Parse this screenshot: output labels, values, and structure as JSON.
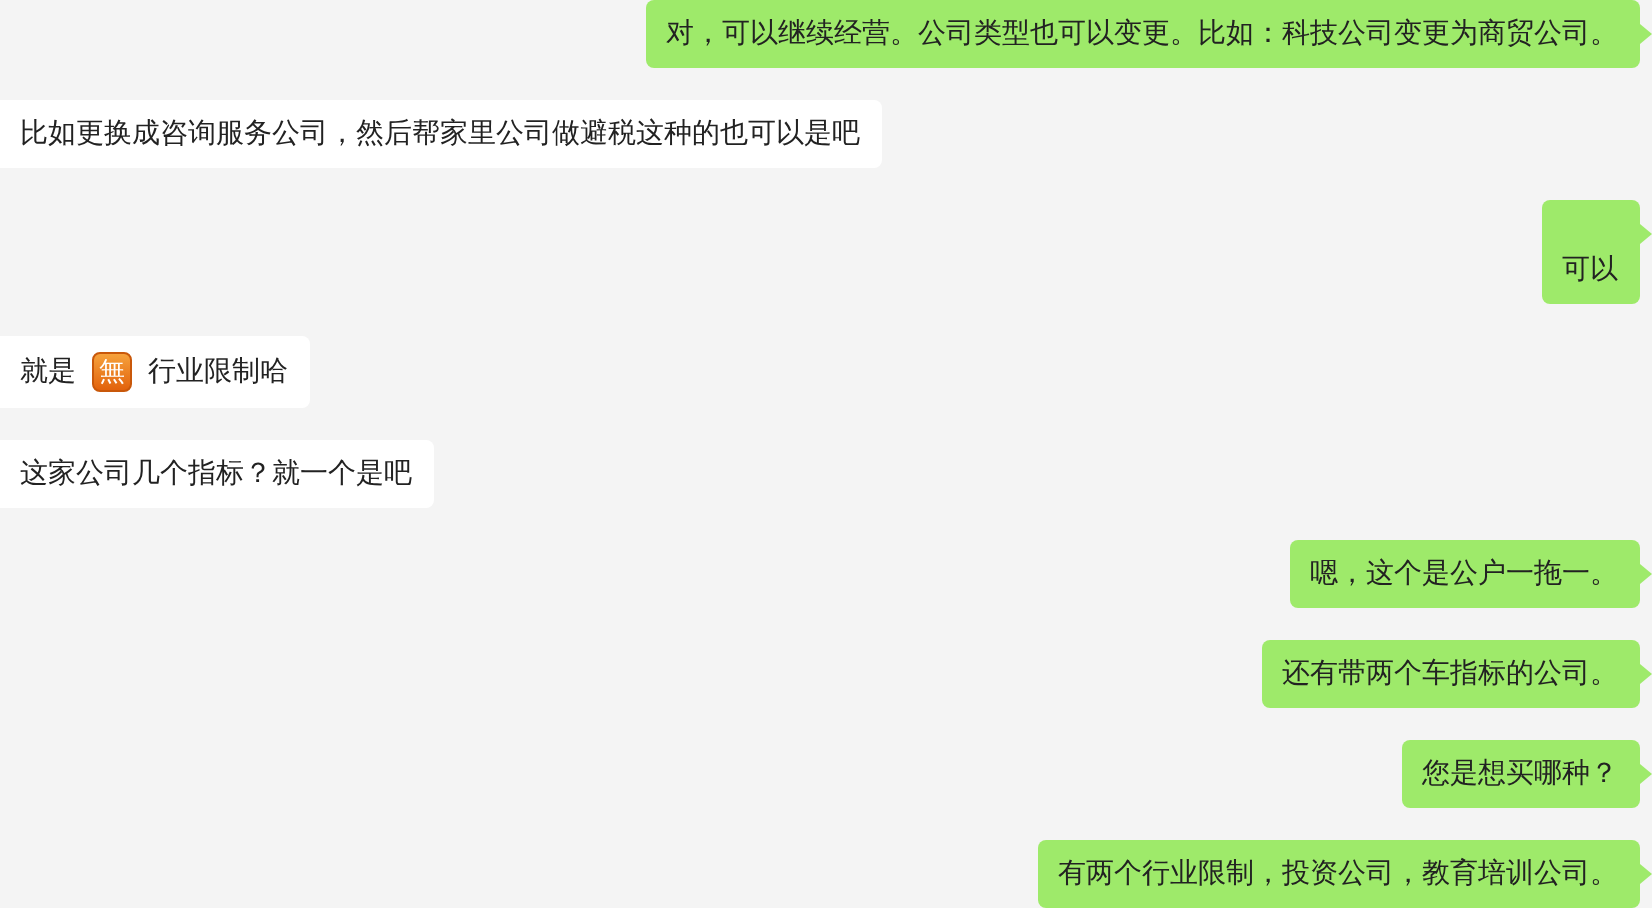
{
  "messages": [
    {
      "kind": "sent",
      "parts": [
        {
          "kind": "text",
          "text": "对，可以继续经营。公司类型也可以变更。比如：科技公司变更为商贸公司。"
        }
      ]
    },
    {
      "kind": "received",
      "parts": [
        {
          "kind": "text",
          "text": "比如更换成咨询服务公司，然后帮家里公司做避税这种的也可以是吧"
        }
      ]
    },
    {
      "kind": "sent",
      "parts": [
        {
          "kind": "text",
          "text": "\n可以"
        }
      ]
    },
    {
      "kind": "received",
      "parts": [
        {
          "kind": "text",
          "text": "就是"
        },
        {
          "kind": "emoji",
          "text": "無"
        },
        {
          "kind": "text",
          "text": "行业限制哈"
        }
      ]
    },
    {
      "kind": "received",
      "parts": [
        {
          "kind": "text",
          "text": "这家公司几个指标？就一个是吧"
        }
      ]
    },
    {
      "kind": "sent",
      "parts": [
        {
          "kind": "text",
          "text": "嗯，这个是公户一拖一。"
        }
      ]
    },
    {
      "kind": "sent",
      "parts": [
        {
          "kind": "text",
          "text": "还有带两个车指标的公司。"
        }
      ]
    },
    {
      "kind": "sent",
      "parts": [
        {
          "kind": "text",
          "text": "您是想买哪种？"
        }
      ]
    },
    {
      "kind": "sent",
      "parts": [
        {
          "kind": "text",
          "text": "有两个行业限制，投资公司，教育培训公司。"
        }
      ]
    }
  ]
}
